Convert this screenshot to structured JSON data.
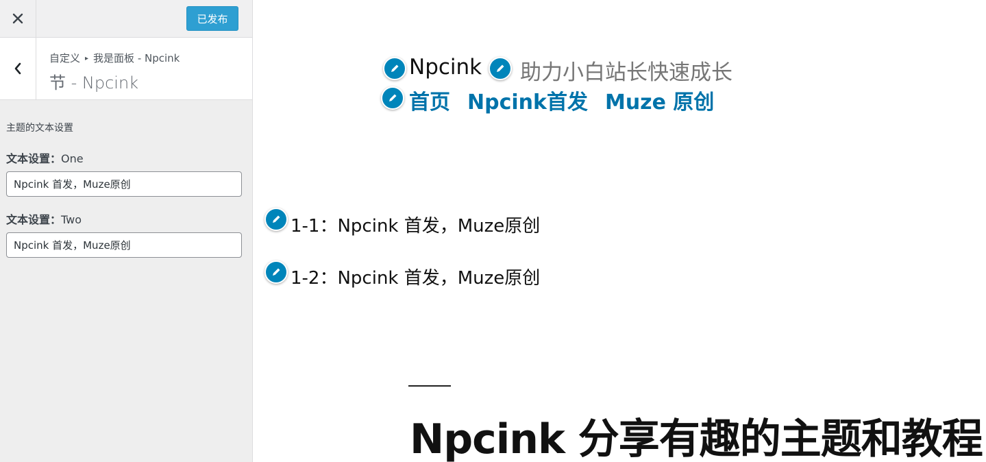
{
  "sidebar": {
    "close_icon": "close-icon",
    "publish_label": "已发布",
    "back_icon": "chevron-left-icon",
    "breadcrumb": {
      "root": "自定义",
      "panel": "我是面板 - Npcink"
    },
    "section_title": "节 - Npcink",
    "controls_description": "主题的文本设置",
    "controls": [
      {
        "label": "文本设置：",
        "label_value": "One",
        "value": "Npcink 首发，Muze原创"
      },
      {
        "label": "文本设置：",
        "label_value": "Two",
        "value": "Npcink 首发，Muze原创"
      }
    ]
  },
  "preview": {
    "site_title": "Npcink",
    "tagline": "助力小白站长快速成长",
    "menu": [
      "首页",
      "Npcink首发",
      "Muze 原创"
    ],
    "text_lines": [
      "1-1：Npcink 首发，Muze原创",
      "1-2：Npcink 首发，Muze原创"
    ],
    "headline": "Npcink 分享有趣的主题和教程"
  },
  "colors": {
    "accent": "#0085ba",
    "publish_button": "#2e9fd2",
    "menu_link": "#0073aa",
    "sidebar_bg": "#eeeeee"
  }
}
